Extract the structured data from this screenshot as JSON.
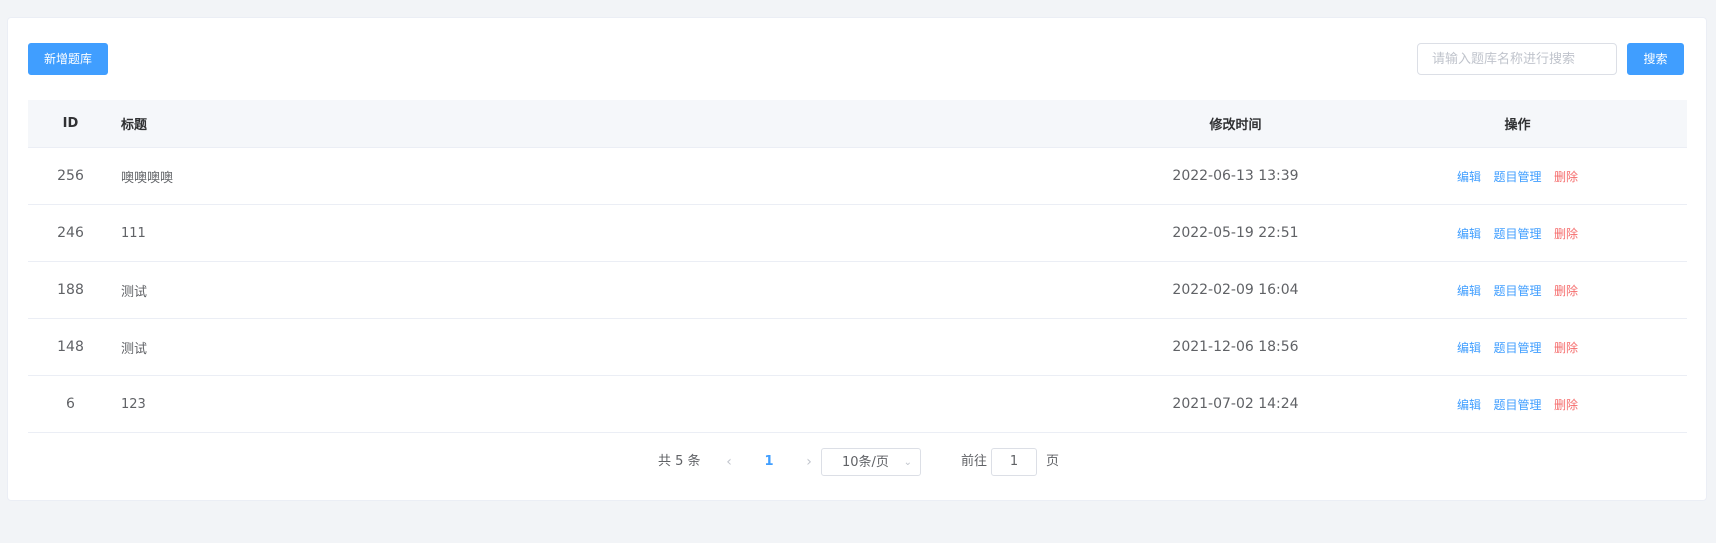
{
  "toolbar": {
    "add_label": "新增题库",
    "search_placeholder": "请输入题库名称进行搜索",
    "search_value": "",
    "search_label": "搜索"
  },
  "table": {
    "headers": [
      "ID",
      "标题",
      "修改时间",
      "操作"
    ],
    "rows": [
      {
        "id": "256",
        "title": "噢噢噢噢",
        "time": "2022-06-13 13:39"
      },
      {
        "id": "246",
        "title": "111",
        "time": "2022-05-19 22:51"
      },
      {
        "id": "188",
        "title": "测试",
        "time": "2022-02-09 16:04"
      },
      {
        "id": "148",
        "title": "测试",
        "time": "2021-12-06 18:56"
      },
      {
        "id": "6",
        "title": "123",
        "time": "2021-07-02 14:24"
      }
    ],
    "ops": {
      "edit": "编辑",
      "manage": "题目管理",
      "delete": "删除"
    }
  },
  "pagination": {
    "total": "共 5 条",
    "current_page": "1",
    "page_size": "10条/页",
    "goto_label": "前往",
    "goto_value": "1",
    "page_unit": "页",
    "prev_icon": "chevron-left-icon",
    "next_icon": "chevron-right-icon"
  },
  "colors": {
    "primary": "#409eff",
    "danger": "#f56c6c",
    "background": "#f2f4f7"
  }
}
